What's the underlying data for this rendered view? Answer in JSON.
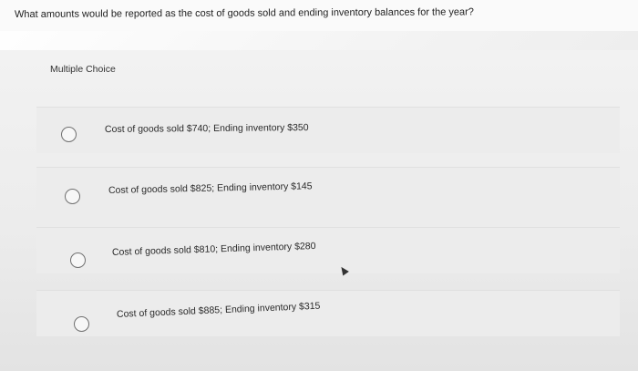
{
  "question": "What amounts would be reported as the cost of goods sold and ending inventory balances for the year?",
  "section_label": "Multiple Choice",
  "options": [
    {
      "label": "Cost of goods sold $740; Ending inventory $350"
    },
    {
      "label": "Cost of goods sold $825; Ending inventory $145"
    },
    {
      "label": "Cost of goods sold $810; Ending inventory $280"
    },
    {
      "label": "Cost of goods sold $885; Ending inventory $315"
    }
  ]
}
